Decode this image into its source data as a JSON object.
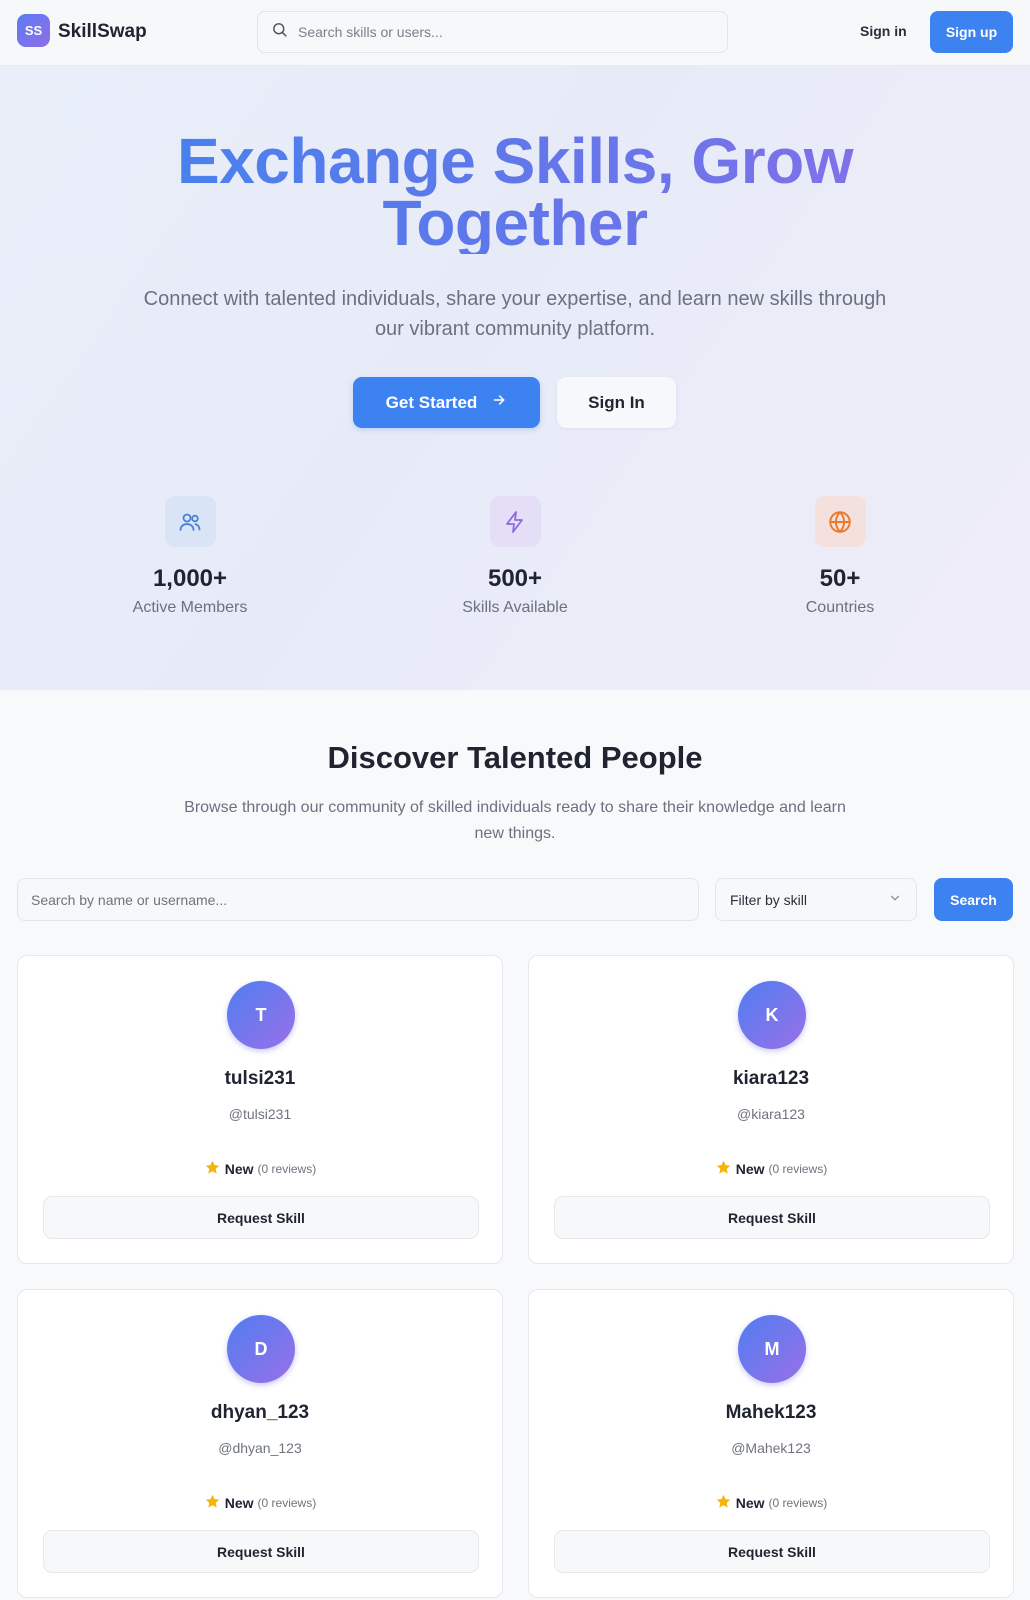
{
  "header": {
    "logo_text": "SS",
    "brand": "SkillSwap",
    "search_placeholder": "Search skills or users...",
    "signin_label": "Sign in",
    "signup_label": "Sign up"
  },
  "hero": {
    "title_line1": "Exchange Skills, Grow",
    "title_line2": "Together",
    "subtitle_line1": "Connect with talented individuals, share your expertise, and learn new skills through",
    "subtitle_line2": "our vibrant community platform.",
    "primary_cta": "Get Started",
    "secondary_cta": "Sign In",
    "stats": [
      {
        "value": "1,000+",
        "label": "Active Members",
        "icon": "users-icon",
        "color": "#4a7fd8"
      },
      {
        "value": "500+",
        "label": "Skills Available",
        "icon": "lightning-icon",
        "color": "#8d6be0"
      },
      {
        "value": "50+",
        "label": "Countries",
        "icon": "globe-icon",
        "color": "#ea7a2c"
      }
    ]
  },
  "discover": {
    "title": "Discover Talented People",
    "subtitle_line1": "Browse through our community of skilled individuals ready to share their knowledge and learn",
    "subtitle_line2": "new things.",
    "name_search_placeholder": "Search by name or username...",
    "filter_label": "Filter by skill",
    "search_button": "Search"
  },
  "users": [
    {
      "initial": "T",
      "name": "tulsi231",
      "handle": "@tulsi231",
      "rating": "New",
      "reviews": "(0 reviews)",
      "action": "Request Skill"
    },
    {
      "initial": "K",
      "name": "kiara123",
      "handle": "@kiara123",
      "rating": "New",
      "reviews": "(0 reviews)",
      "action": "Request Skill"
    },
    {
      "initial": "D",
      "name": "dhyan_123",
      "handle": "@dhyan_123",
      "rating": "New",
      "reviews": "(0 reviews)",
      "action": "Request Skill"
    },
    {
      "initial": "M",
      "name": "Mahek123",
      "handle": "@Mahek123",
      "rating": "New",
      "reviews": "(0 reviews)",
      "action": "Request Skill"
    }
  ],
  "colors": {
    "accent": "#3d82f1",
    "gradient_start": "#3f86ee",
    "gradient_end": "#8f6ee8",
    "star": "#f5b50a"
  }
}
